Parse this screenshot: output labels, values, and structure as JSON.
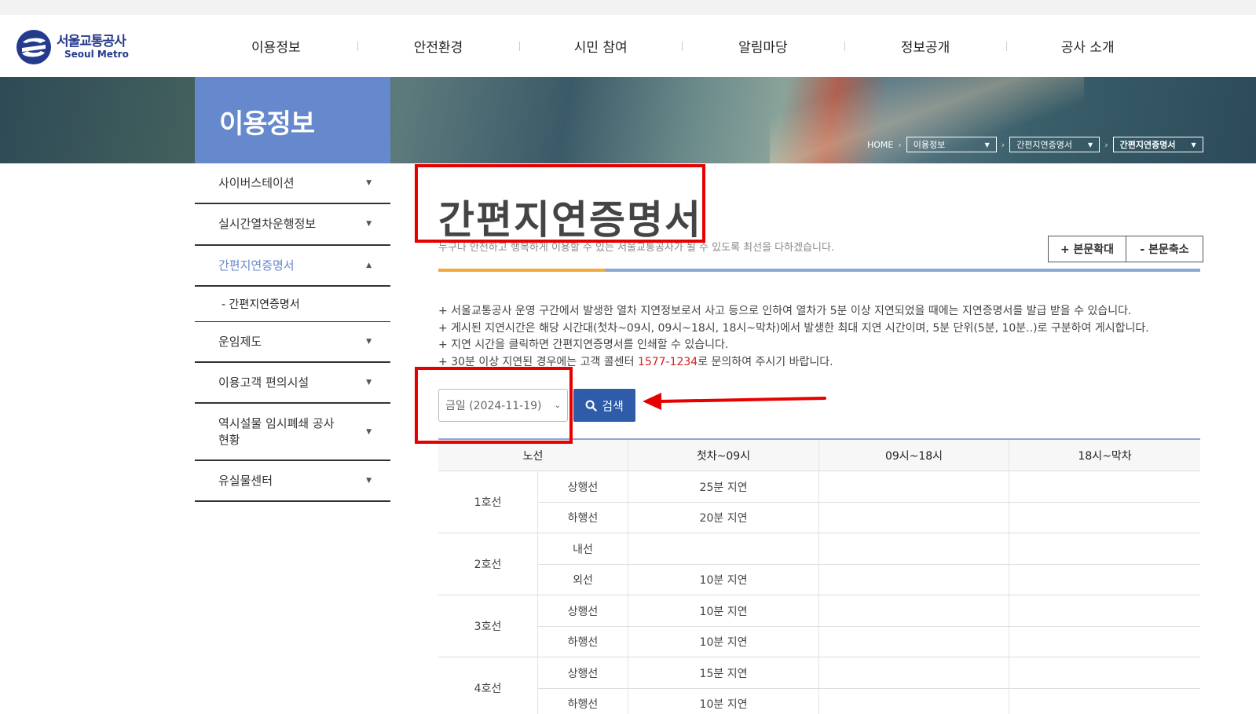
{
  "header": {
    "logo_ko": "서울교통공사",
    "logo_en": "Seoul Metro",
    "nav": [
      "이용정보",
      "안전환경",
      "시민 참여",
      "알림마당",
      "정보공개",
      "공사 소개"
    ]
  },
  "banner": {
    "title": "이용정보",
    "breadcrumb": {
      "home": "HOME",
      "level1": "이용정보",
      "level2": "간편지연증명서",
      "level3": "간편지연증명서"
    }
  },
  "sidebar": {
    "items": [
      {
        "label": "사이버스테이션"
      },
      {
        "label": "실시간열차운행정보"
      },
      {
        "label": "간편지연증명서"
      },
      {
        "label": "운임제도"
      },
      {
        "label": "이용고객 편의시설"
      },
      {
        "label": "역시설물 임시폐쇄 공사현황"
      },
      {
        "label": "유실물센터"
      }
    ],
    "sub_item": "- 간편지연증명서"
  },
  "main": {
    "title": "간편지연증명서",
    "subtitle": "누구나 안전하고 행복하게 이용할 수 있는 서울교통공사가 될 수 있도록 최선을 다하겠습니다.",
    "zoom_in": "+ 본문확대",
    "zoom_out": "- 본문축소",
    "notes": [
      "+ 서울교통공사 운영 구간에서 발생한 열차 지연정보로서 사고 등으로 인하여 열차가 5분 이상 지연되었을 때에는 지연증명서를 발급 받을 수 있습니다.",
      "+ 게시된 지연시간은 해당 시간대(첫차~09시, 09시~18시, 18시~막차)에서 발생한 최대 지연 시간이며, 5분 단위(5분, 10분..)로 구분하여 게시합니다.",
      "+ 지연 시간을 클릭하면 간편지연증명서를 인쇄할 수 있습니다."
    ],
    "note4_pre": "+ 30분 이상 지연된 경우에는 고객 콜센터 ",
    "note4_tel": "1577-1234",
    "note4_post": "로 문의하여 주시기 바랍니다.",
    "date_select": "금일 (2024-11-19)",
    "search_label": "검색"
  },
  "table": {
    "headers": [
      "노선",
      "첫차~09시",
      "09시~18시",
      "18시~막차"
    ],
    "groups": [
      {
        "line": "1호선",
        "rows": [
          {
            "dir": "상행선",
            "t1": "25분 지연",
            "t2": "",
            "t3": ""
          },
          {
            "dir": "하행선",
            "t1": "20분 지연",
            "t2": "",
            "t3": ""
          }
        ]
      },
      {
        "line": "2호선",
        "rows": [
          {
            "dir": "내선",
            "t1": "",
            "t2": "",
            "t3": ""
          },
          {
            "dir": "외선",
            "t1": "10분 지연",
            "t2": "",
            "t3": ""
          }
        ]
      },
      {
        "line": "3호선",
        "rows": [
          {
            "dir": "상행선",
            "t1": "10분 지연",
            "t2": "",
            "t3": ""
          },
          {
            "dir": "하행선",
            "t1": "10분 지연",
            "t2": "",
            "t3": ""
          }
        ]
      },
      {
        "line": "4호선",
        "rows": [
          {
            "dir": "상행선",
            "t1": "15분 지연",
            "t2": "",
            "t3": ""
          },
          {
            "dir": "하행선",
            "t1": "10분 지연",
            "t2": "",
            "t3": ""
          }
        ]
      }
    ]
  },
  "colors": {
    "accent_blue": "#6688cc",
    "button_blue": "#2f5ca8",
    "annotation_red": "#e60000",
    "title_bar_orange": "#f2a93b"
  }
}
